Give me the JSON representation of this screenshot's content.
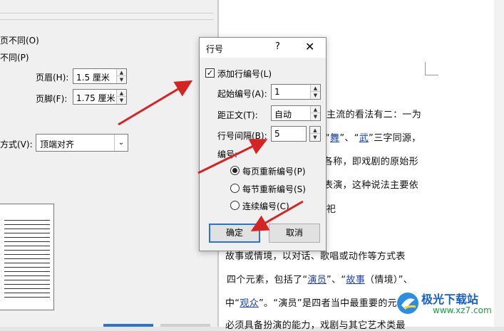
{
  "background_dialog": {
    "option_odd_even": "页不同(O)",
    "option_first_page": "不同(P)",
    "header_label": "页眉(H):",
    "header_value": "1.5 厘米",
    "footer_label": "页脚(F):",
    "footer_value": "1.75 厘米",
    "valign_label": "方式(V):",
    "valign_value": "顶端对齐"
  },
  "document": {
    "lines": [
      {
        "parts": [
          {
            "text": "主流的看法有二：一为"
          }
        ]
      },
      {
        "parts": [
          {
            "text": "“"
          },
          {
            "text": "舞",
            "link": true
          },
          {
            "text": "”、“"
          },
          {
            "text": "武",
            "link": true
          },
          {
            "text": "”三字同源，"
          }
        ]
      },
      {
        "parts": [
          {
            "text": "各称，即戏剧的原始形"
          }
        ]
      },
      {
        "parts": [
          {
            "text": "表演，这种说法主要依"
          }
        ]
      },
      {
        "parts": [
          {
            "text": "祀"
          }
        ]
      },
      {
        "parts": [
          {
            "text": "故事或情境，以对话、歌唱或动作等方式表"
          }
        ]
      },
      {
        "parts": [
          {
            "text": "四个元素，包括了“"
          },
          {
            "text": "演员",
            "link": true
          },
          {
            "text": "”、“"
          },
          {
            "text": "故事",
            "link": true
          },
          {
            "text": "（情境）”、"
          }
        ]
      },
      {
        "parts": [
          {
            "text": "中“"
          },
          {
            "text": "观众",
            "link": true
          },
          {
            "text": "”。“演员”是四者当中最重要的元素，"
          }
        ]
      },
      {
        "parts": [
          {
            "text": "必须具备扮演的能力，戏剧与其它艺术类最"
          }
        ]
      }
    ]
  },
  "line_number_dialog": {
    "title": "行号",
    "help": "?",
    "close": "✕",
    "add_line_numbers": {
      "label": "添加行编号(L)",
      "checked": true
    },
    "start_at": {
      "label": "起始编号(A):",
      "value": "1"
    },
    "from_text": {
      "label": "距正文(T):",
      "value": "自动"
    },
    "count_by": {
      "label": "行号间隔(B):",
      "value": "5"
    },
    "numbering_label": "编号:",
    "numbering_options": [
      {
        "label": "每页重新编号(P)",
        "selected": true
      },
      {
        "label": "每节重新编号(S)",
        "selected": false
      },
      {
        "label": "连续编号(C)",
        "selected": false
      }
    ],
    "ok_label": "确定",
    "cancel_label": "取消"
  },
  "watermark": {
    "name": "极光下载站",
    "url": "www.xz7.com"
  },
  "colors": {
    "arrow": "#d42424",
    "link": "#1a3fb6",
    "focus_border": "#2a74d0"
  }
}
